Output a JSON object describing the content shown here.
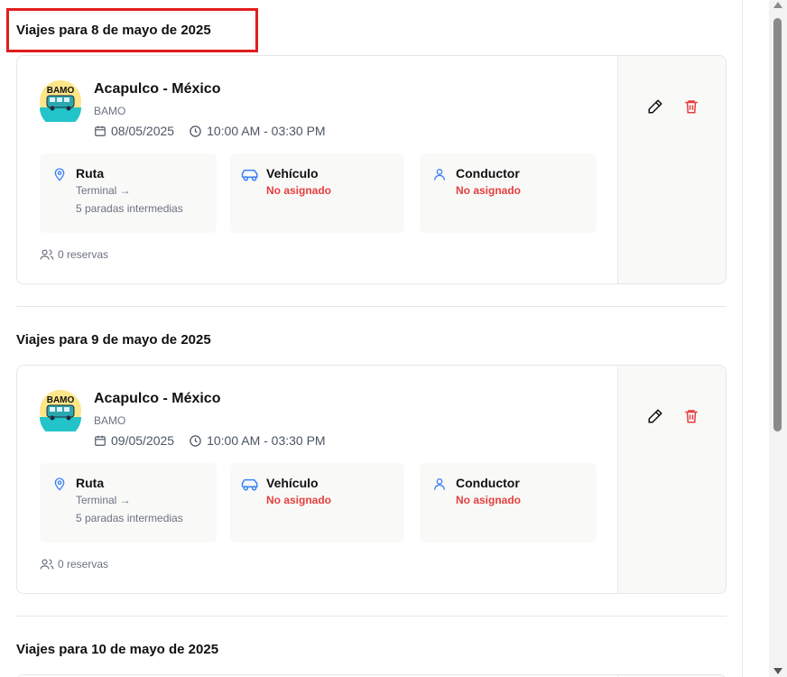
{
  "sections": [
    {
      "title": "Viajes para 8 de mayo de 2025",
      "trip": {
        "title": "Acapulco - México",
        "company": "BAMO",
        "logo_text": "BAMO",
        "date": "08/05/2025",
        "time": "10:00 AM - 03:30 PM",
        "route": {
          "label": "Ruta",
          "origin": "Terminal →",
          "stops": "5 paradas intermedias"
        },
        "vehicle": {
          "label": "Vehículo",
          "status": "No asignado"
        },
        "driver": {
          "label": "Conductor",
          "status": "No asignado"
        },
        "reservations": "0 reservas"
      }
    },
    {
      "title": "Viajes para 9 de mayo de 2025",
      "trip": {
        "title": "Acapulco - México",
        "company": "BAMO",
        "logo_text": "BAMO",
        "date": "09/05/2025",
        "time": "10:00 AM - 03:30 PM",
        "route": {
          "label": "Ruta",
          "origin": "Terminal →",
          "stops": "5 paradas intermedias"
        },
        "vehicle": {
          "label": "Vehículo",
          "status": "No asignado"
        },
        "driver": {
          "label": "Conductor",
          "status": "No asignado"
        },
        "reservations": "0 reservas"
      }
    },
    {
      "title": "Viajes para 10 de mayo de 2025"
    }
  ],
  "colors": {
    "accent_blue": "#3b82f6",
    "status_red": "#e53e3e",
    "highlight_red": "#e11d1d",
    "delete_red": "#e53e3e"
  },
  "icons": {
    "calendar": "calendar-icon",
    "clock": "clock-icon",
    "route": "map-pin-icon",
    "vehicle": "car-icon",
    "driver": "user-icon",
    "reservations": "users-icon",
    "edit": "pencil-icon",
    "delete": "trash-icon"
  }
}
